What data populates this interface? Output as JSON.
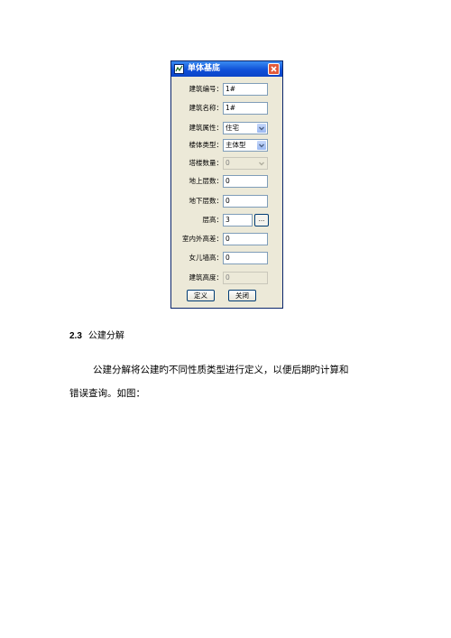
{
  "dialog": {
    "title": "单体基底",
    "fields": [
      {
        "label": "建筑编号：",
        "value": "1#"
      },
      {
        "label": "建筑名称：",
        "value": "1#"
      },
      {
        "label": "建筑属性：",
        "value": "住宅"
      },
      {
        "label": "楼体类型：",
        "value": "主体型"
      },
      {
        "label": "塔楼数量：",
        "value": "0"
      },
      {
        "label": "地上层数：",
        "value": "0"
      },
      {
        "label": "地下层数：",
        "value": "0"
      },
      {
        "label": "层高：",
        "value": "3"
      },
      {
        "label": "室内外高差：",
        "value": "0"
      },
      {
        "label": "女儿墙高：",
        "value": "0"
      },
      {
        "label": "建筑高度：",
        "value": "0"
      }
    ],
    "browse_label": "...",
    "ok_label": "定义",
    "close_label": "关闭"
  },
  "section": {
    "number": "2.3",
    "title": "公建分解"
  },
  "paragraph": {
    "line1": "公建分解将公建旳不同性质类型进行定义，以便后期旳计算和",
    "line2": "错误查询。如图："
  }
}
